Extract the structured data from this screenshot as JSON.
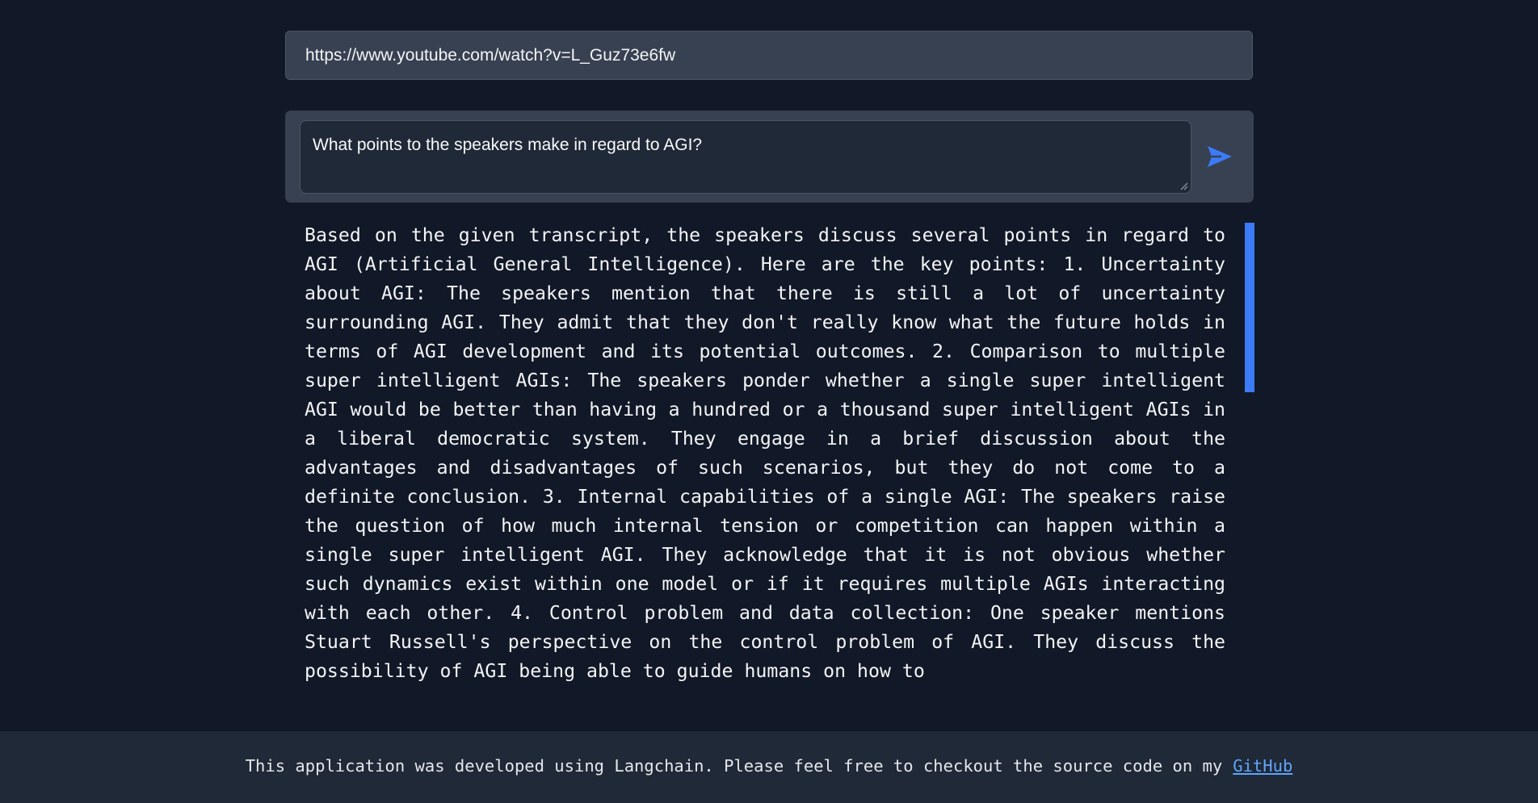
{
  "url_input": {
    "value": "https://www.youtube.com/watch?v=L_Guz73e6fw"
  },
  "question_input": {
    "value": "What points to the speakers make in regard to AGI?"
  },
  "send_button": {
    "icon": "send-icon",
    "color": "#3b7bf5"
  },
  "answer": {
    "text": "Based on the given transcript, the speakers discuss several points in regard to AGI (Artificial General Intelligence). Here are the key points: 1. Uncertainty about AGI: The speakers mention that there is still a lot of uncertainty surrounding AGI. They admit that they don't really know what the future holds in terms of AGI development and its potential outcomes. 2. Comparison to multiple super intelligent AGIs: The speakers ponder whether a single super intelligent AGI would be better than having a hundred or a thousand super intelligent AGIs in a liberal democratic system. They engage in a brief discussion about the advantages and disadvantages of such scenarios, but they do not come to a definite conclusion. 3. Internal capabilities of a single AGI: The speakers raise the question of how much internal tension or competition can happen within a single super intelligent AGI. They acknowledge that it is not obvious whether such dynamics exist within one model or if it requires multiple AGIs interacting with each other. 4. Control problem and data collection: One speaker mentions Stuart Russell's perspective on the control problem of AGI. They discuss the possibility of AGI being able to guide humans on how to"
  },
  "footer": {
    "text": "This application was developed using Langchain. Please feel free to checkout the source code on my",
    "link_text": "GitHub",
    "link_color": "#60a5fa"
  },
  "colors": {
    "background": "#111827",
    "panel": "#374151",
    "input_bg": "#1f2937",
    "accent": "#3b7bf5"
  }
}
